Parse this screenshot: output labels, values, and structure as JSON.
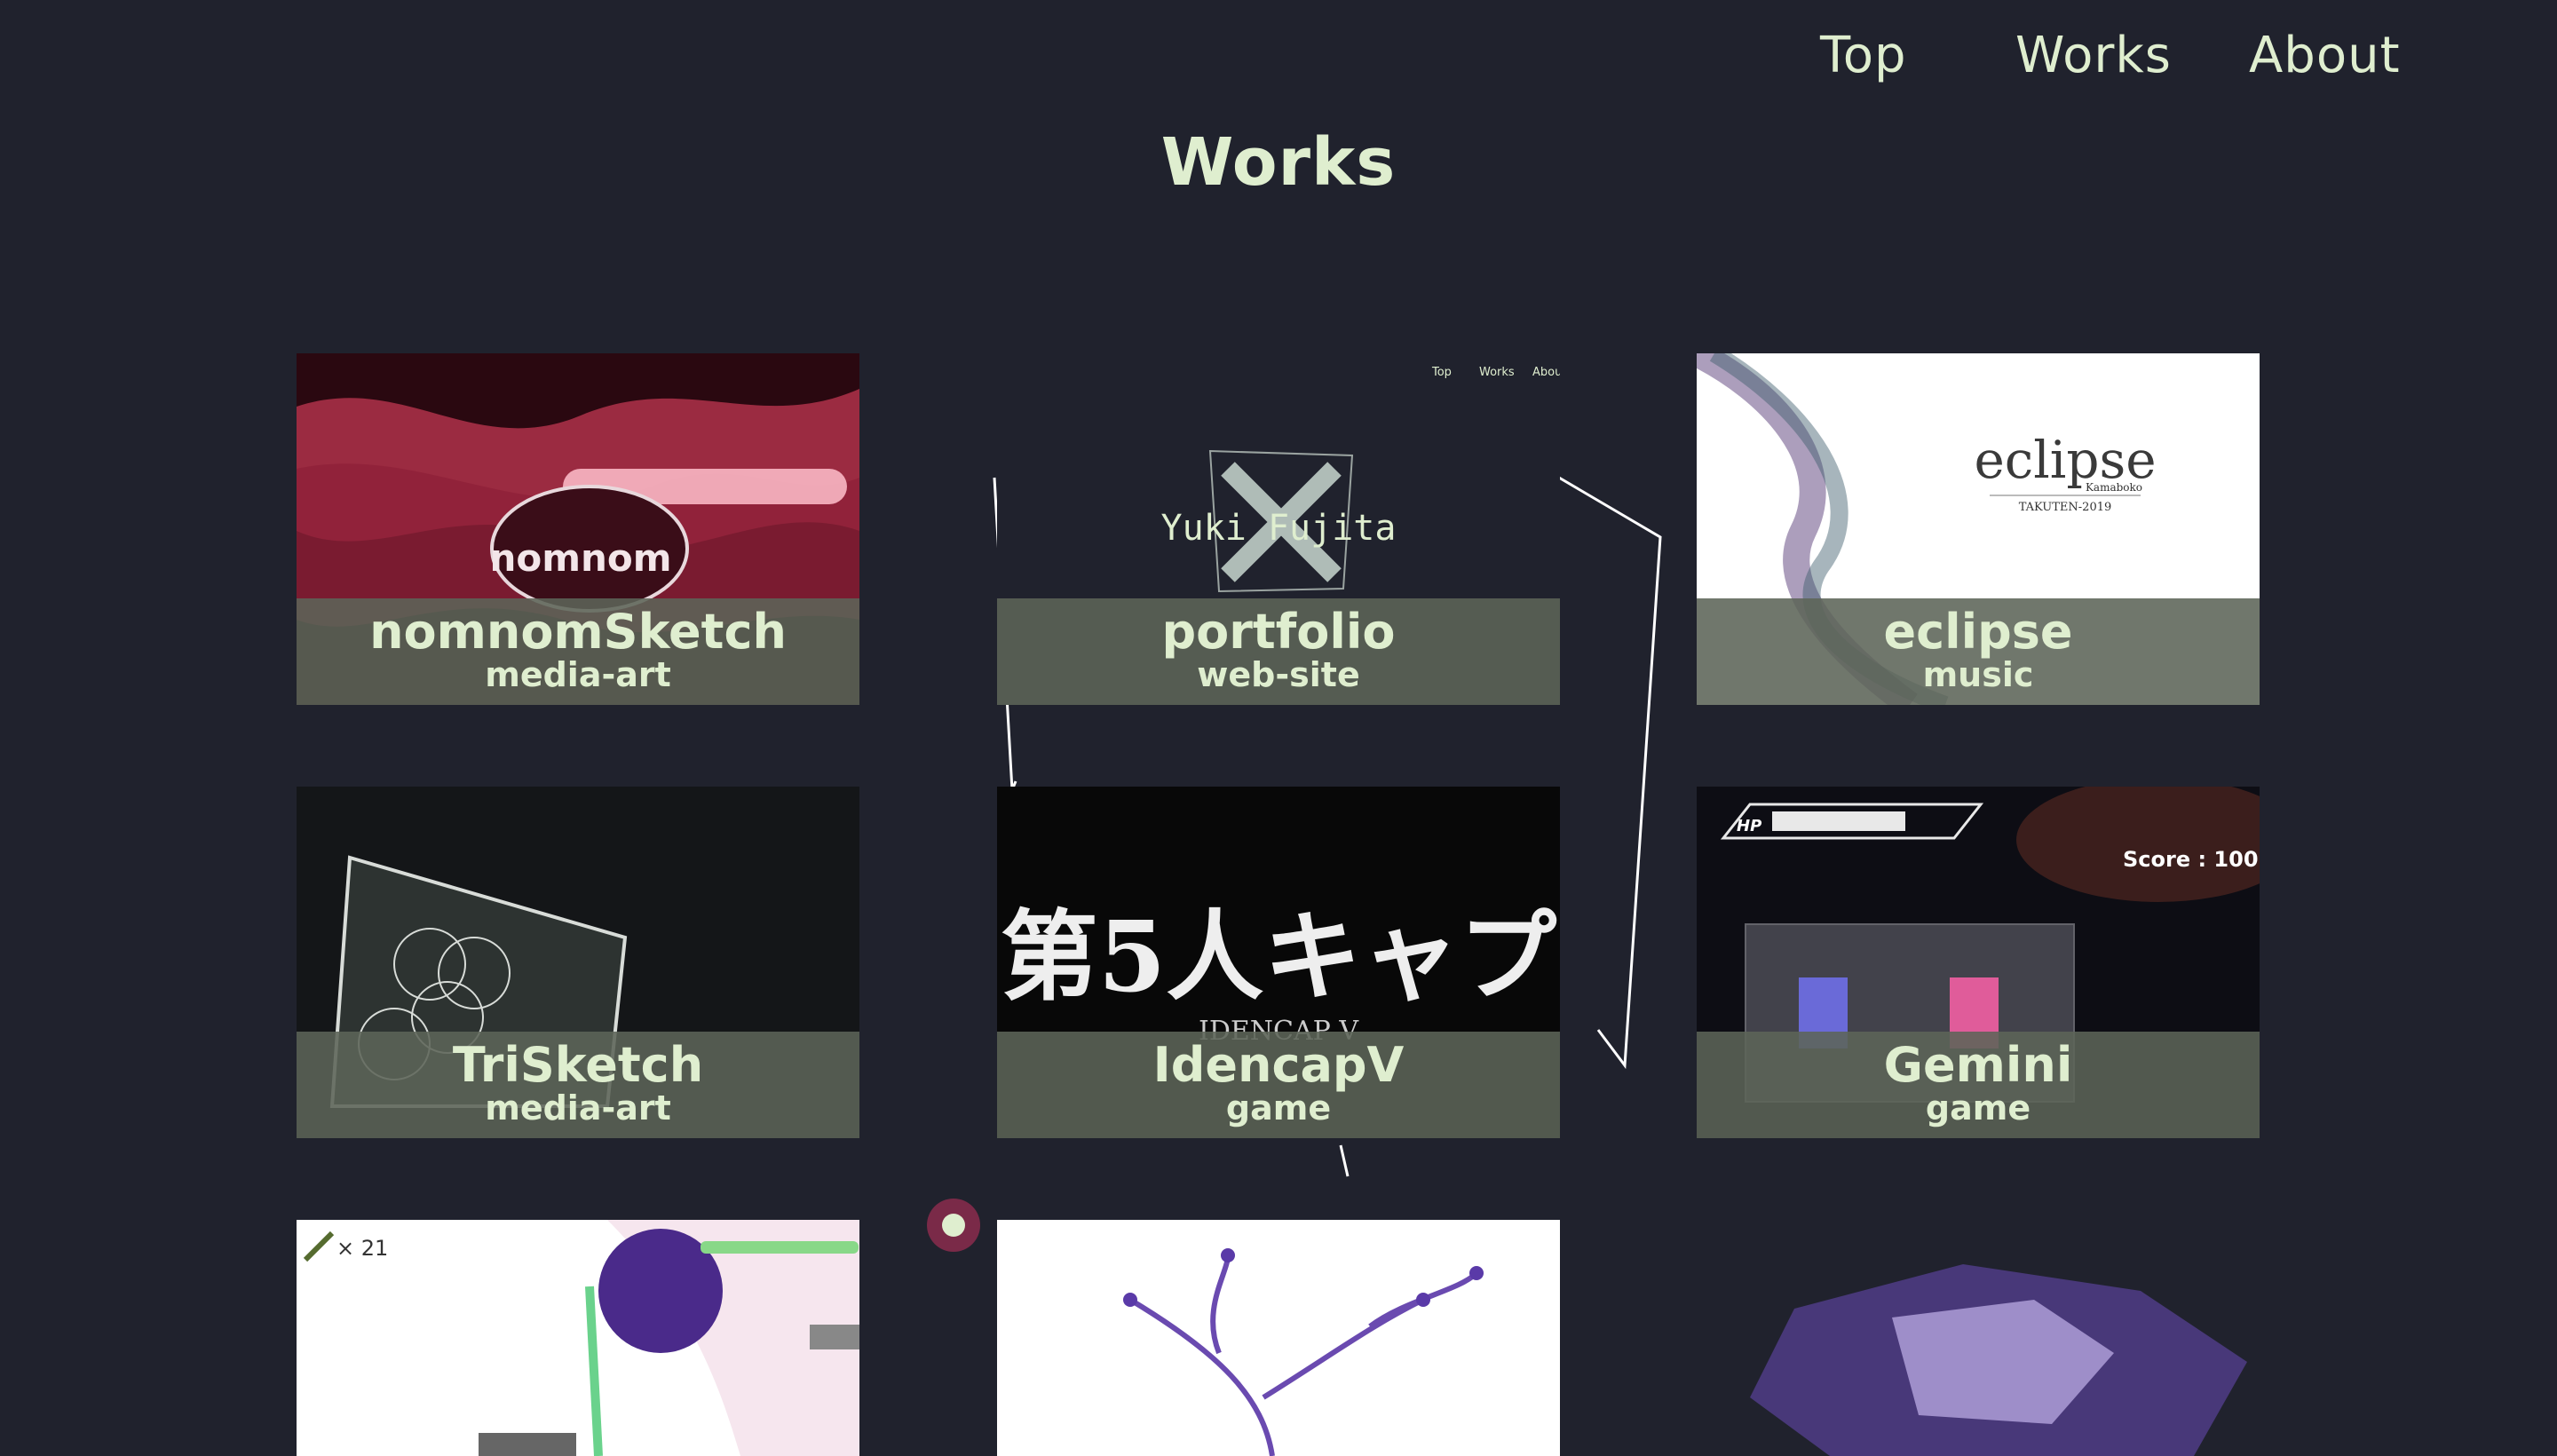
{
  "nav": {
    "top": "Top",
    "works": "Works",
    "about": "About"
  },
  "page": {
    "title": "Works"
  },
  "works": [
    {
      "name": "nomnomSketch",
      "category": "media-art",
      "thumb_text": "nomnom"
    },
    {
      "name": "portfolio",
      "category": "web-site",
      "thumb_text": "Yuki Fujita",
      "mini_nav": [
        "Top",
        "Works",
        "Abou"
      ]
    },
    {
      "name": "eclipse",
      "category": "music",
      "thumb_text": "eclipse",
      "thumb_sub": "Kamaboko",
      "thumb_sub2": "TAKUTEN-2019"
    },
    {
      "name": "TriSketch",
      "category": "media-art"
    },
    {
      "name": "IdencapV",
      "category": "game",
      "thumb_text": "第5人キャプ",
      "thumb_sub": "IDENCAP V"
    },
    {
      "name": "Gemini",
      "category": "game",
      "thumb_hp": "HP",
      "thumb_score": "Score : 100"
    },
    {
      "thumb_count": "× 21"
    },
    {},
    {}
  ],
  "colors": {
    "background": "#20222d",
    "text": "#dfeecf",
    "label_bg": "#5c6458"
  }
}
